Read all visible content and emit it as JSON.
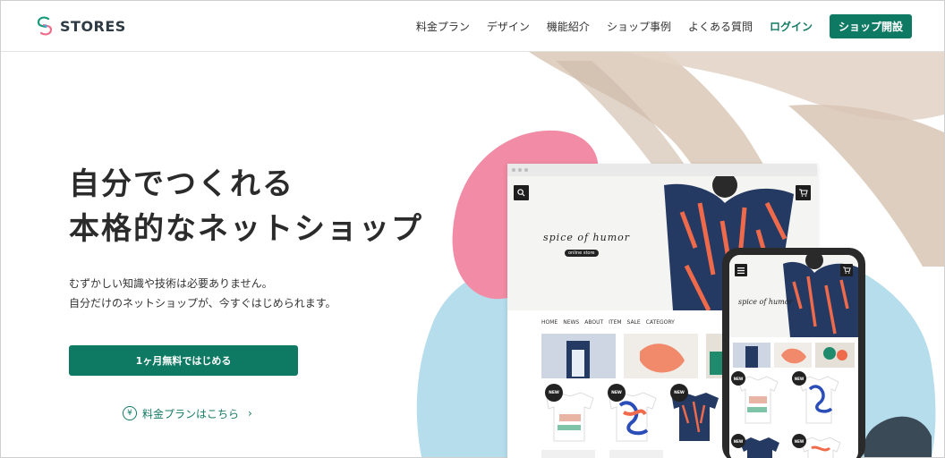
{
  "header": {
    "logo_text": "STORES",
    "nav": [
      {
        "label": "料金プラン"
      },
      {
        "label": "デザイン"
      },
      {
        "label": "機能紹介"
      },
      {
        "label": "ショップ事例"
      },
      {
        "label": "よくある質問"
      }
    ],
    "login_label": "ログイン",
    "open_shop_label": "ショップ開設"
  },
  "hero": {
    "title_line1": "自分でつくれる",
    "title_line2": "本格的なネットショップ",
    "sub_line1": "むずかしい知識や技術は必要ありません。",
    "sub_line2": "自分だけのネットショップが、今すぐはじめられます。",
    "cta_label": "1ヶ月無料ではじめる",
    "price_link_label": "料金プランはこちら",
    "yen_symbol": "¥"
  },
  "mock_shop": {
    "brand": "spice of humor",
    "brand_tag": "online store",
    "nav": [
      "HOME",
      "NEWS",
      "ABOUT",
      "ITEM",
      "SALE",
      "CATEGORY"
    ],
    "new_label": "NEW"
  },
  "colors": {
    "accent": "#0f7a63",
    "pink": "#f28ba5",
    "blue": "#b5ddec",
    "beige": "#dccbbb"
  },
  "icons": [
    "logo-icon",
    "search-icon",
    "cart-icon",
    "menu-icon",
    "yen-icon",
    "chevron-right-icon"
  ]
}
